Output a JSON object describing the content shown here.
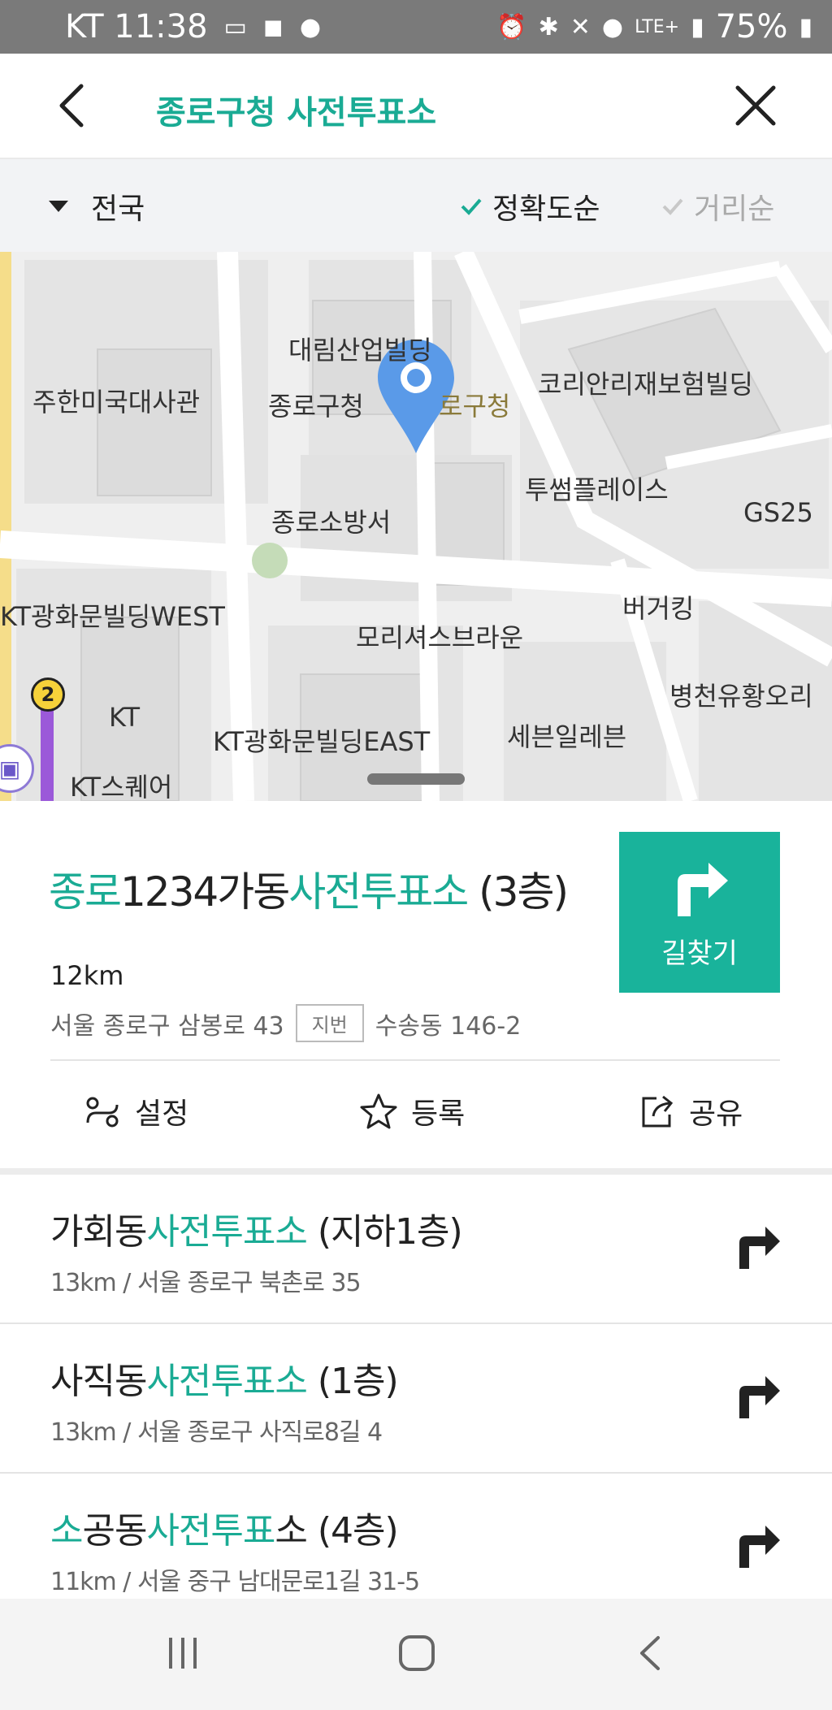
{
  "status_bar": {
    "carrier_time": "KT 11:38",
    "battery": "75%",
    "network": "LTE+"
  },
  "header": {
    "title": "종로구청 사전투표소"
  },
  "filter": {
    "region": "전국",
    "sort_accuracy": "정확도순",
    "sort_distance": "거리순"
  },
  "map": {
    "labels": {
      "daelim": "대림산업빌딩",
      "korean_re": "코리안리재보험빌딩",
      "us_embassy": "주한미국대사관",
      "jongno_gu_office": "종로구청",
      "gu_office_marker": "로구청",
      "tuthum": "투썸플레이스",
      "gs25": "GS25",
      "fire_station": "종로소방서",
      "kt_west": "KT광화문빌딩WEST",
      "burger_king": "버거킹",
      "morrisons": "모리셔스브라운",
      "byeongcheon": "병천유황오리",
      "kt": "KT",
      "kt_east": "KT광화문빌딩EAST",
      "seven_eleven": "세븐일레븐",
      "kt_square": "KT스퀘어",
      "subway_line": "2"
    }
  },
  "selected_place": {
    "name_part1": "종로",
    "name_part2": "1234가동",
    "name_part3": "사전투표소",
    "name_part4": " (3층)",
    "distance": "12km",
    "address": "서울 종로구 삼봉로 43",
    "jibun_badge": "지번",
    "jibun_address": "수송동 146-2",
    "route_label": "길찾기",
    "actions": {
      "settings": "설정",
      "register": "등록",
      "share": "공유"
    }
  },
  "results": [
    {
      "name_a": "가회동",
      "name_b": "사전투표소",
      "name_c": " (지하1층)",
      "sub": "13km / 서울 종로구 북촌로 35"
    },
    {
      "name_a": "사직동",
      "name_b": "사전투표소",
      "name_c": " (1층)",
      "sub": "13km / 서울 종로구 사직로8길 4"
    },
    {
      "name_a0": "소",
      "name_a": "공동",
      "name_b": "사전투표",
      "name_c": "소 (4층)",
      "sub": "11km / 서울 중구 남대문로1길 31-5"
    }
  ],
  "colors": {
    "accent": "#1aab94",
    "route_button": "#19b39b",
    "map_pin": "#5a9ae8"
  }
}
